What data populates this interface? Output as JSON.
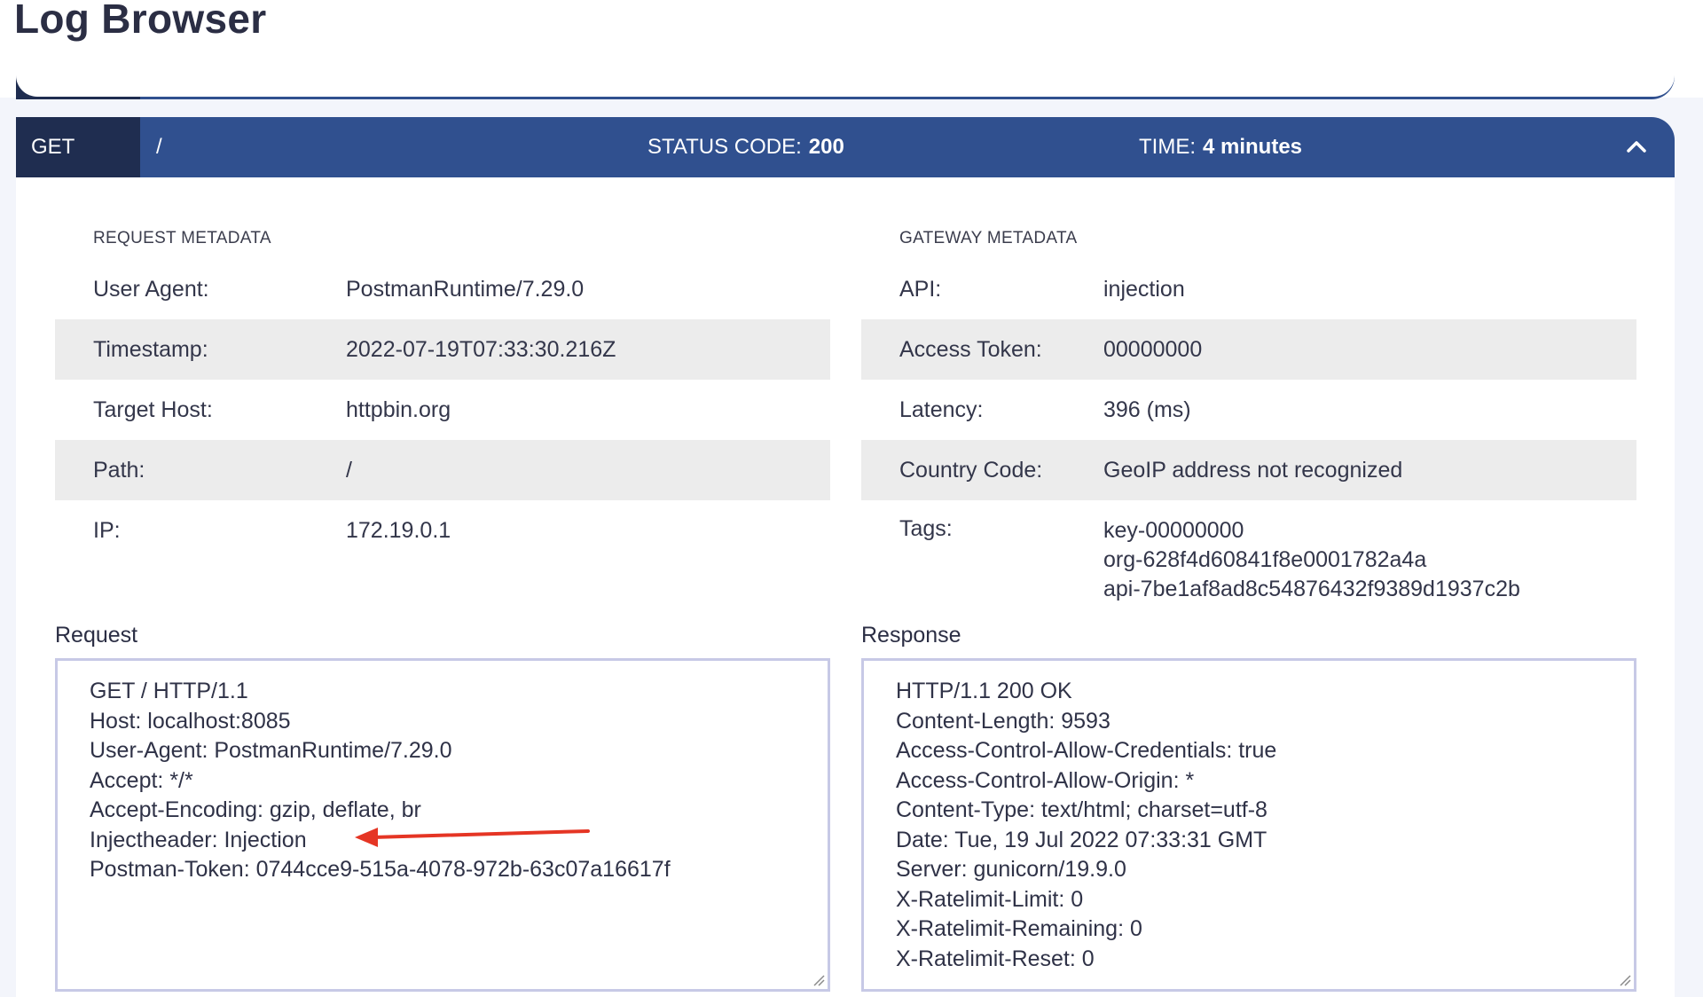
{
  "page": {
    "title": "Log Browser"
  },
  "entry": {
    "method": "GET",
    "path": "/",
    "status_label": "STATUS CODE:",
    "status_value": "200",
    "time_label": "TIME:",
    "time_value": "4 minutes"
  },
  "request_metadata": {
    "heading": "REQUEST METADATA",
    "rows": [
      {
        "key": "User Agent:",
        "value": "PostmanRuntime/7.29.0"
      },
      {
        "key": "Timestamp:",
        "value": "2022-07-19T07:33:30.216Z"
      },
      {
        "key": "Target Host:",
        "value": "httpbin.org"
      },
      {
        "key": "Path:",
        "value": "/"
      },
      {
        "key": "IP:",
        "value": "172.19.0.1"
      }
    ]
  },
  "gateway_metadata": {
    "heading": "GATEWAY METADATA",
    "rows": [
      {
        "key": "API:",
        "value": "injection"
      },
      {
        "key": "Access Token:",
        "value": "00000000"
      },
      {
        "key": "Latency:",
        "value": "396 (ms)"
      },
      {
        "key": "Country Code:",
        "value": "GeoIP address not recognized"
      }
    ],
    "tags_label": "Tags:",
    "tags": [
      "key-00000000",
      "org-628f4d60841f8e0001782a4a",
      "api-7be1af8ad8c54876432f9389d1937c2b"
    ]
  },
  "request": {
    "title": "Request",
    "lines": [
      "GET / HTTP/1.1",
      "Host: localhost:8085",
      "User-Agent: PostmanRuntime/7.29.0",
      "Accept: */*",
      "Accept-Encoding: gzip, deflate, br",
      "Injectheader: Injection",
      "Postman-Token: 0744cce9-515a-4078-972b-63c07a16617f"
    ]
  },
  "response": {
    "title": "Response",
    "lines": [
      "HTTP/1.1 200 OK",
      "Content-Length: 9593",
      "Access-Control-Allow-Credentials: true",
      "Access-Control-Allow-Origin: *",
      "Content-Type: text/html; charset=utf-8",
      "Date: Tue, 19 Jul 2022 07:33:31 GMT",
      "Server: gunicorn/19.9.0",
      "X-Ratelimit-Limit: 0",
      "X-Ratelimit-Remaining: 0",
      "X-Ratelimit-Reset: 0"
    ]
  },
  "colors": {
    "header_bg": "#30508f",
    "method_bg": "#1f2d50",
    "annotation_arrow": "#e53524"
  },
  "icons": {
    "collapse": "chevron-up-icon",
    "annotation": "arrow-left-icon",
    "resize": "resize-handle-icon"
  }
}
